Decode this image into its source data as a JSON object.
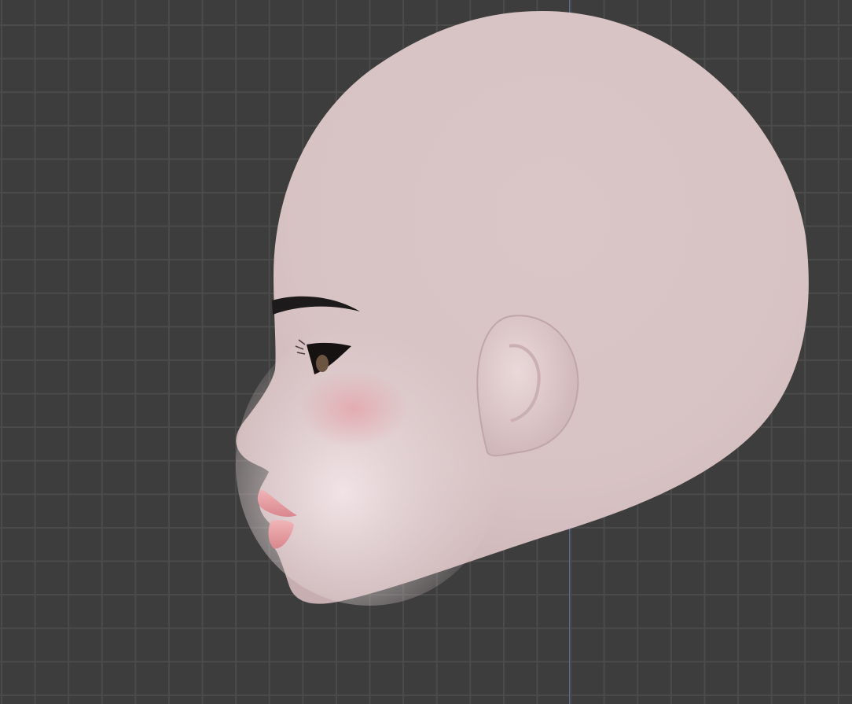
{
  "viewport": {
    "background": "#3d3d3d",
    "grid_line": "#4b4b4b",
    "axis_line": "#5a6f96"
  },
  "object": {
    "skin": "#dcc9c9",
    "skin_shadow": "#c9b2b2",
    "blush": "#e0a7ac",
    "lips": "#e79a9e"
  }
}
